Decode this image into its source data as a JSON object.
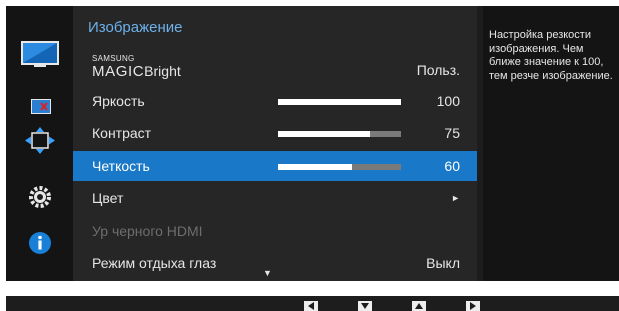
{
  "menu": {
    "title": "Изображение",
    "magic_bright": {
      "label_small": "SAMSUNG",
      "label_big": "MAGIC",
      "label_suffix": "Bright",
      "value": "Польз."
    },
    "brightness": {
      "label": "Яркость",
      "value": "100",
      "level": 1.0
    },
    "contrast": {
      "label": "Контраст",
      "value": "75",
      "level": 0.75
    },
    "sharpness": {
      "label": "Четкость",
      "value": "60",
      "level": 0.6
    },
    "color": {
      "label": "Цвет",
      "arrow": "►"
    },
    "hdmi_black": {
      "label": "Ур черного HDMI"
    },
    "eye_saver": {
      "label": "Режим отдыха глаз",
      "value": "Выкл"
    },
    "more_arrow": "▼"
  },
  "help": {
    "text": "Настройка резкости\nизображения. Чем\nближе значение к 100,\nтем резче изображение."
  },
  "side_icons": [
    "picture-icon",
    "screen-adjust-icon",
    "position-icon",
    "settings-icon",
    "info-icon"
  ],
  "nav_buttons": [
    "left-icon",
    "down-icon",
    "up-icon",
    "right-icon"
  ],
  "colors": {
    "accent": "#1978c7",
    "title": "#6db0ea",
    "info": "#1a7fd6"
  }
}
